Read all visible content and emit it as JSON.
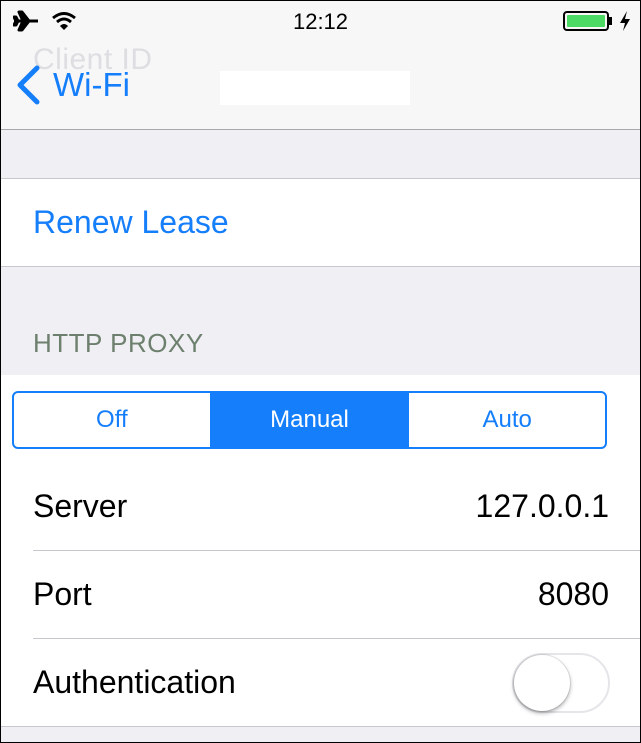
{
  "status_bar": {
    "time": "12:12",
    "icons": [
      "airplane-icon",
      "wifi-icon",
      "battery-icon",
      "charging-bolt-icon"
    ]
  },
  "nav": {
    "back_label": "Wi-Fi",
    "faded_title": "Client ID"
  },
  "renew": {
    "label": "Renew Lease"
  },
  "http_proxy": {
    "header": "HTTP PROXY",
    "segments": [
      "Off",
      "Manual",
      "Auto"
    ],
    "selected": "Manual",
    "server_label": "Server",
    "server_value": "127.0.0.1",
    "port_label": "Port",
    "port_value": "8080",
    "auth_label": "Authentication",
    "auth_enabled": false
  },
  "colors": {
    "accent": "#157efb",
    "background": "#efeff4",
    "battery": "#4cd964",
    "section_header": "#6d7f6d"
  }
}
